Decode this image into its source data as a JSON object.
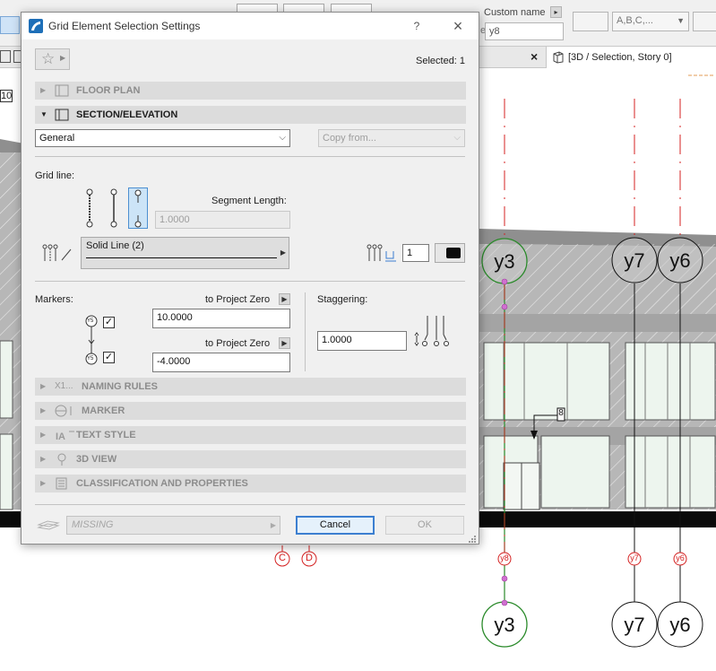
{
  "app": {
    "custom_name_label": "Custom name",
    "name_field_prefix": "e:",
    "name_field_value": "y8",
    "format_select_value": "A,B,C,...",
    "tab_label": "[3D / Selection, Story 0]",
    "tab_close": "×",
    "left_field_value": "10",
    "marker_dimension": "8"
  },
  "drawing": {
    "grid_markers": [
      {
        "label": "y3",
        "style": "selected"
      },
      {
        "label": "y7",
        "style": "normal"
      },
      {
        "label": "y6",
        "style": "normal"
      }
    ],
    "bottom_markers": [
      {
        "label": "y3",
        "style": "selected"
      },
      {
        "label": "y7",
        "style": "normal"
      },
      {
        "label": "y6",
        "style": "normal"
      }
    ],
    "small_labels": [
      "y8",
      "y7",
      "y6"
    ],
    "axis_markers": [
      "C",
      "D"
    ],
    "colors": {
      "red_line": "#d42020",
      "selected_green": "#2a8a2a",
      "facade": "#b5b5b5",
      "glass": "#eaf3ea"
    }
  },
  "dialog": {
    "title": "Grid Element Selection Settings",
    "help": "?",
    "close": "×",
    "selected_text": "Selected: 1",
    "sections": {
      "floor_plan": "FLOOR PLAN",
      "section_elevation": "SECTION/ELEVATION",
      "naming_rules": "NAMING RULES",
      "naming_rules_icon_text": "X1...",
      "marker": "MARKER",
      "text_style": "TEXT STYLE",
      "view_3d": "3D VIEW",
      "classification": "CLASSIFICATION AND PROPERTIES"
    },
    "general_select": "General",
    "copy_from": "Copy from...",
    "grid_line_label": "Grid line:",
    "segment_length_label": "Segment Length:",
    "segment_length_value": "1.0000",
    "line_type": "Solid Line (2)",
    "pen_number": "1",
    "markers_label": "Markers:",
    "to_project_zero_1": "to Project Zero",
    "marker_value_1": "10.0000",
    "to_project_zero_2": "to Project Zero",
    "marker_value_2": "-4.0000",
    "staggering_label": "Staggering:",
    "staggering_value": "1.0000",
    "marker_symbol": "Y5",
    "missing_label": "MISSING",
    "cancel": "Cancel",
    "ok": "OK",
    "marker_begin_checked": true,
    "marker_end_checked": true
  }
}
